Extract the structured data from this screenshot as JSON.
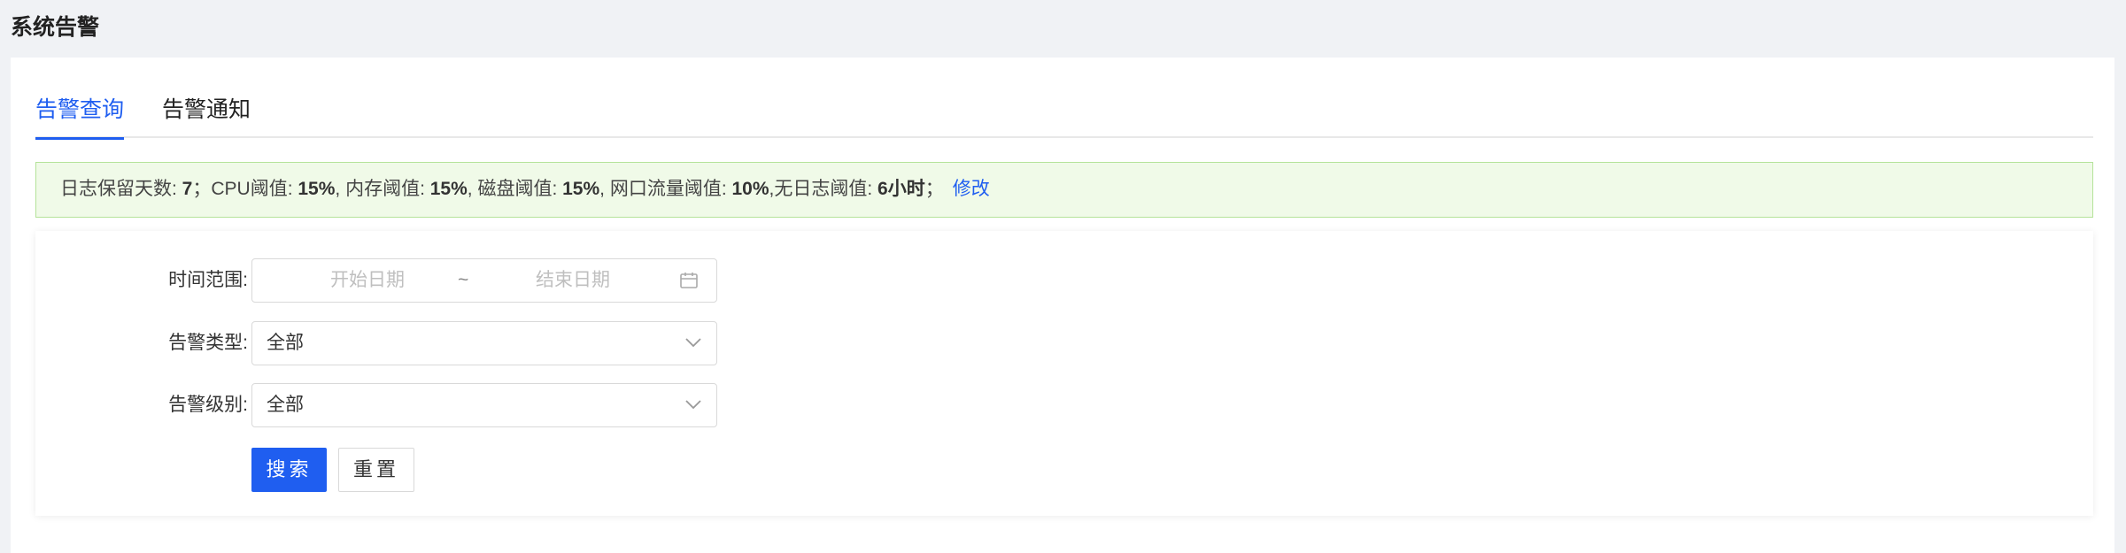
{
  "page": {
    "title": "系统告警"
  },
  "tabs": [
    {
      "label": "告警查询",
      "active": true
    },
    {
      "label": "告警通知",
      "active": false
    }
  ],
  "notice": {
    "log_days_label": "日志保留天数: ",
    "log_days_value": "7",
    "cpu_label": "；CPU阈值: ",
    "cpu_value": "15%",
    "mem_label": ", 内存阈值: ",
    "mem_value": "15%",
    "disk_label": ", 磁盘阈值: ",
    "disk_value": "15%",
    "net_label": ", 网口流量阈值: ",
    "net_value": "10%",
    "nolog_label": ",无日志阈值: ",
    "nolog_value": "6小时",
    "end_sep": "；",
    "edit_link": "修改"
  },
  "filters": {
    "time_range": {
      "label": "时间范围:",
      "start_placeholder": "开始日期",
      "separator": "~",
      "end_placeholder": "结束日期"
    },
    "alert_type": {
      "label": "告警类型:",
      "value": "全部"
    },
    "alert_level": {
      "label": "告警级别:",
      "value": "全部"
    }
  },
  "buttons": {
    "search": "搜索",
    "reset": "重置"
  },
  "colors": {
    "primary": "#1f5ef0",
    "notice_bg": "#f0fae8",
    "notice_border": "#b5e39a"
  },
  "icons": {
    "date": "calendar-icon",
    "select": "chevron-down-icon"
  }
}
